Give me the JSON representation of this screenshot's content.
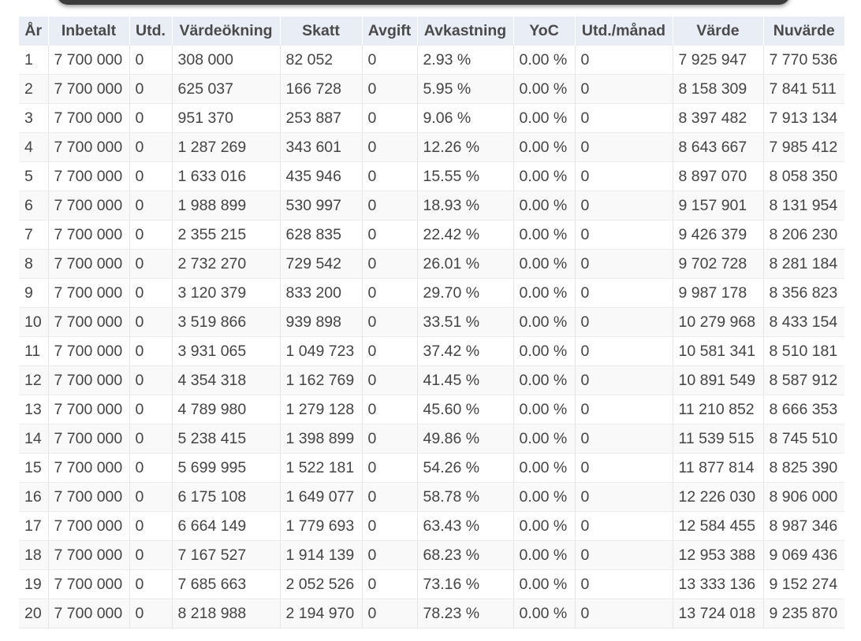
{
  "table": {
    "columns": [
      "År",
      "Inbetalt",
      "Utd.",
      "Värdeökning",
      "Skatt",
      "Avgift",
      "Avkastning",
      "YoC",
      "Utd./månad",
      "Värde",
      "Nuvärde"
    ],
    "rows": [
      [
        "1",
        "7 700 000",
        "0",
        "308 000",
        "82 052",
        "0",
        "2.93 %",
        "0.00 %",
        "0",
        "7 925 947",
        "7 770 536"
      ],
      [
        "2",
        "7 700 000",
        "0",
        "625 037",
        "166 728",
        "0",
        "5.95 %",
        "0.00 %",
        "0",
        "8 158 309",
        "7 841 511"
      ],
      [
        "3",
        "7 700 000",
        "0",
        "951 370",
        "253 887",
        "0",
        "9.06 %",
        "0.00 %",
        "0",
        "8 397 482",
        "7 913 134"
      ],
      [
        "4",
        "7 700 000",
        "0",
        "1 287 269",
        "343 601",
        "0",
        "12.26 %",
        "0.00 %",
        "0",
        "8 643 667",
        "7 985 412"
      ],
      [
        "5",
        "7 700 000",
        "0",
        "1 633 016",
        "435 946",
        "0",
        "15.55 %",
        "0.00 %",
        "0",
        "8 897 070",
        "8 058 350"
      ],
      [
        "6",
        "7 700 000",
        "0",
        "1 988 899",
        "530 997",
        "0",
        "18.93 %",
        "0.00 %",
        "0",
        "9 157 901",
        "8 131 954"
      ],
      [
        "7",
        "7 700 000",
        "0",
        "2 355 215",
        "628 835",
        "0",
        "22.42 %",
        "0.00 %",
        "0",
        "9 426 379",
        "8 206 230"
      ],
      [
        "8",
        "7 700 000",
        "0",
        "2 732 270",
        "729 542",
        "0",
        "26.01 %",
        "0.00 %",
        "0",
        "9 702 728",
        "8 281 184"
      ],
      [
        "9",
        "7 700 000",
        "0",
        "3 120 379",
        "833 200",
        "0",
        "29.70 %",
        "0.00 %",
        "0",
        "9 987 178",
        "8 356 823"
      ],
      [
        "10",
        "7 700 000",
        "0",
        "3 519 866",
        "939 898",
        "0",
        "33.51 %",
        "0.00 %",
        "0",
        "10 279 968",
        "8 433 154"
      ],
      [
        "11",
        "7 700 000",
        "0",
        "3 931 065",
        "1 049 723",
        "0",
        "37.42 %",
        "0.00 %",
        "0",
        "10 581 341",
        "8 510 181"
      ],
      [
        "12",
        "7 700 000",
        "0",
        "4 354 318",
        "1 162 769",
        "0",
        "41.45 %",
        "0.00 %",
        "0",
        "10 891 549",
        "8 587 912"
      ],
      [
        "13",
        "7 700 000",
        "0",
        "4 789 980",
        "1 279 128",
        "0",
        "45.60 %",
        "0.00 %",
        "0",
        "11 210 852",
        "8 666 353"
      ],
      [
        "14",
        "7 700 000",
        "0",
        "5 238 415",
        "1 398 899",
        "0",
        "49.86 %",
        "0.00 %",
        "0",
        "11 539 515",
        "8 745 510"
      ],
      [
        "15",
        "7 700 000",
        "0",
        "5 699 995",
        "1 522 181",
        "0",
        "54.26 %",
        "0.00 %",
        "0",
        "11 877 814",
        "8 825 390"
      ],
      [
        "16",
        "7 700 000",
        "0",
        "6 175 108",
        "1 649 077",
        "0",
        "58.78 %",
        "0.00 %",
        "0",
        "12 226 030",
        "8 906 000"
      ],
      [
        "17",
        "7 700 000",
        "0",
        "6 664 149",
        "1 779 693",
        "0",
        "63.43 %",
        "0.00 %",
        "0",
        "12 584 455",
        "8 987 346"
      ],
      [
        "18",
        "7 700 000",
        "0",
        "7 167 527",
        "1 914 139",
        "0",
        "68.23 %",
        "0.00 %",
        "0",
        "12 953 388",
        "9 069 436"
      ],
      [
        "19",
        "7 700 000",
        "0",
        "7 685 663",
        "2 052 526",
        "0",
        "73.16 %",
        "0.00 %",
        "0",
        "13 333 136",
        "9 152 274"
      ],
      [
        "20",
        "7 700 000",
        "0",
        "8 218 988",
        "2 194 970",
        "0",
        "78.23 %",
        "0.00 %",
        "0",
        "13 724 018",
        "9 235 870"
      ]
    ]
  }
}
